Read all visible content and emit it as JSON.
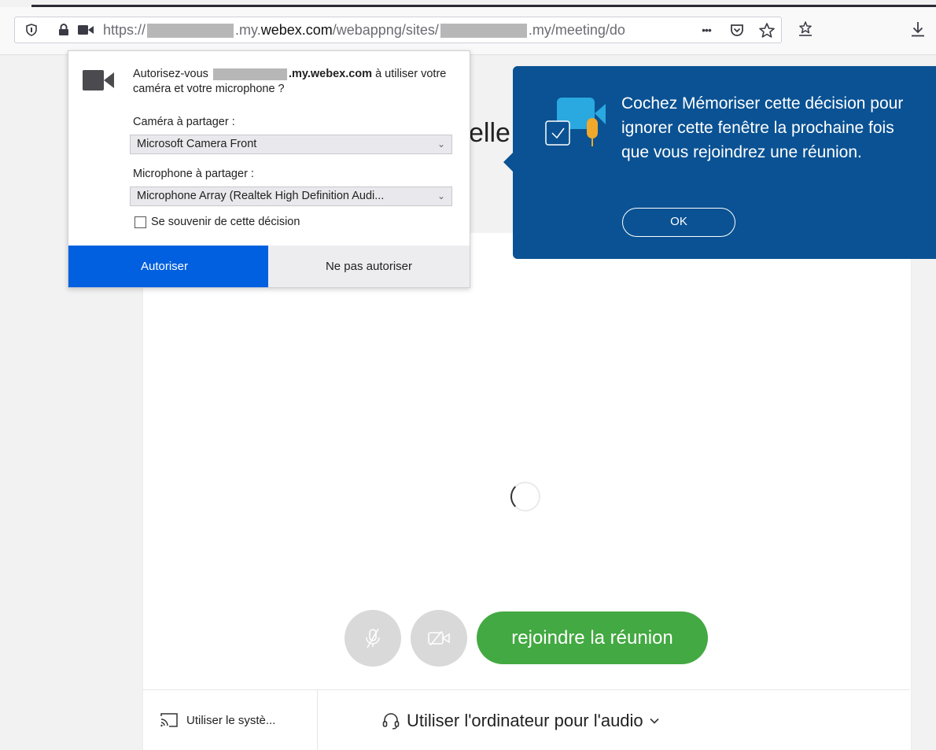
{
  "browser": {
    "url": {
      "scheme": "https://",
      "part1": ".my.",
      "domain": "webex.com",
      "part2": "/webappng/sites/",
      "part3": ".my/meeting/do"
    },
    "icons": [
      "shield-icon",
      "lock-icon",
      "camera-permission-icon",
      "more-icon",
      "pocket-icon",
      "star-icon",
      "reading-list-icon",
      "download-icon"
    ],
    "more_glyph": "•••"
  },
  "permission_popup": {
    "question_prefix": "Autorisez-vous",
    "question_domain": ".my.webex.com",
    "question_suffix": "à utiliser votre caméra et votre microphone ?",
    "camera_label": "Caméra à partager :",
    "camera_value": "Microsoft Camera Front",
    "microphone_label": "Microphone à partager :",
    "microphone_value": "Microphone Array (Realtek High Definition Audi...",
    "remember_label": "Se souvenir de cette décision",
    "allow_label": "Autoriser",
    "deny_label": "Ne pas autoriser"
  },
  "tooltip": {
    "text": "Cochez Mémoriser cette décision pour ignorer cette fenêtre la prochaine fois que vous rejoindrez une réunion.",
    "ok_label": "OK"
  },
  "meeting": {
    "title_fragment": "elle",
    "join_label": "rejoindre la réunion",
    "system_label": "Utiliser le systè...",
    "audio_label": "Utiliser l'ordinateur pour l'audio"
  },
  "colors": {
    "allow_blue": "#0060df",
    "tooltip_blue": "#0a5293",
    "join_green": "#43a942"
  }
}
